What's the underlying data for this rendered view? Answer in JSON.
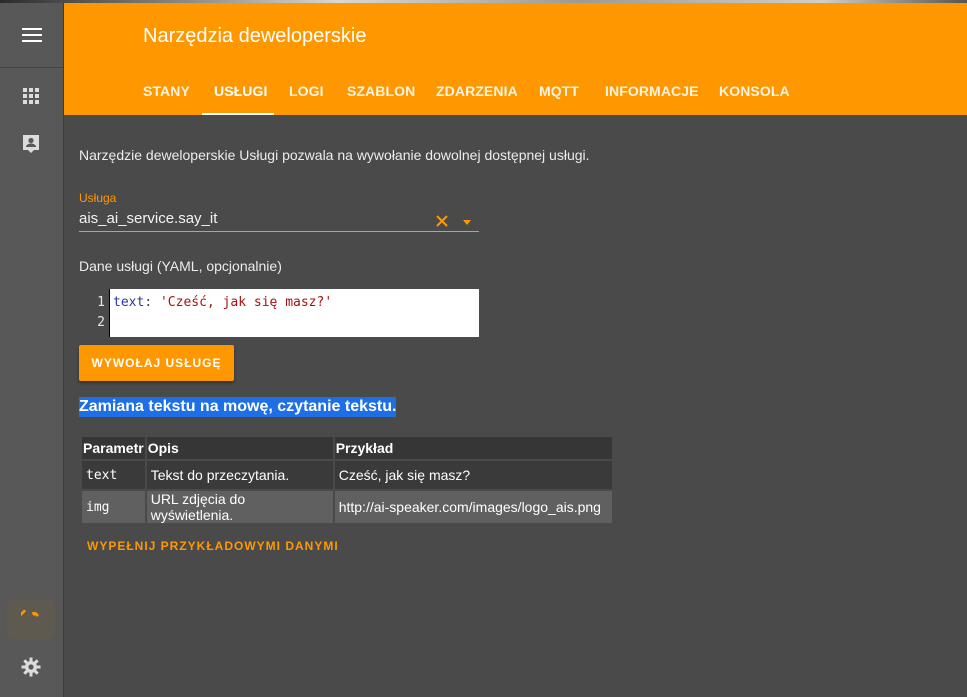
{
  "header": {
    "title": "Narzędzia deweloperskie",
    "tabs": [
      {
        "label": "STANY"
      },
      {
        "label": "USŁUGI"
      },
      {
        "label": "LOGI"
      },
      {
        "label": "SZABLON"
      },
      {
        "label": "ZDARZENIA"
      },
      {
        "label": "MQTT"
      },
      {
        "label": "INFORMACJE"
      },
      {
        "label": "KONSOLA"
      }
    ],
    "active_tab": "USŁUGI"
  },
  "sidebar": {
    "icons": [
      "menu-icon",
      "apps-grid-icon",
      "contact-card-icon",
      "hammer-icon",
      "settings-gear-icon"
    ],
    "active": "hammer-icon"
  },
  "main": {
    "intro": "Narzędzie deweloperskie Usługi pozwala na wywołanie dowolnej dostępnej usługi.",
    "service_field": {
      "label": "Usługa",
      "value": "ais_ai_service.say_it"
    },
    "yaml_label": "Dane usługi (YAML, opcjonalnie)",
    "editor": {
      "line_numbers": [
        "1",
        "2"
      ],
      "key": "text",
      "sep": ": ",
      "string": "'Cześć, jak się masz?'"
    },
    "call_button": "WYWOŁAJ USŁUGĘ",
    "service_description": "Zamiana tekstu na mowę, czytanie tekstu.",
    "table": {
      "headers": [
        "Parametr",
        "Opis",
        "Przykład"
      ],
      "rows": [
        [
          "text",
          "Tekst do przeczytania.",
          "Cześć, jak się masz?"
        ],
        [
          "img",
          "URL zdjęcia do wyświetlenia.",
          "http://ai-speaker.com/images/logo_ais.png"
        ]
      ]
    },
    "fill_example_button": "WYPEŁNIJ PRZYKŁADOWYMI DANYMI"
  },
  "colors": {
    "accent": "#ff9800",
    "selection": "#1e6ee6",
    "background": "#4a4a4a"
  }
}
